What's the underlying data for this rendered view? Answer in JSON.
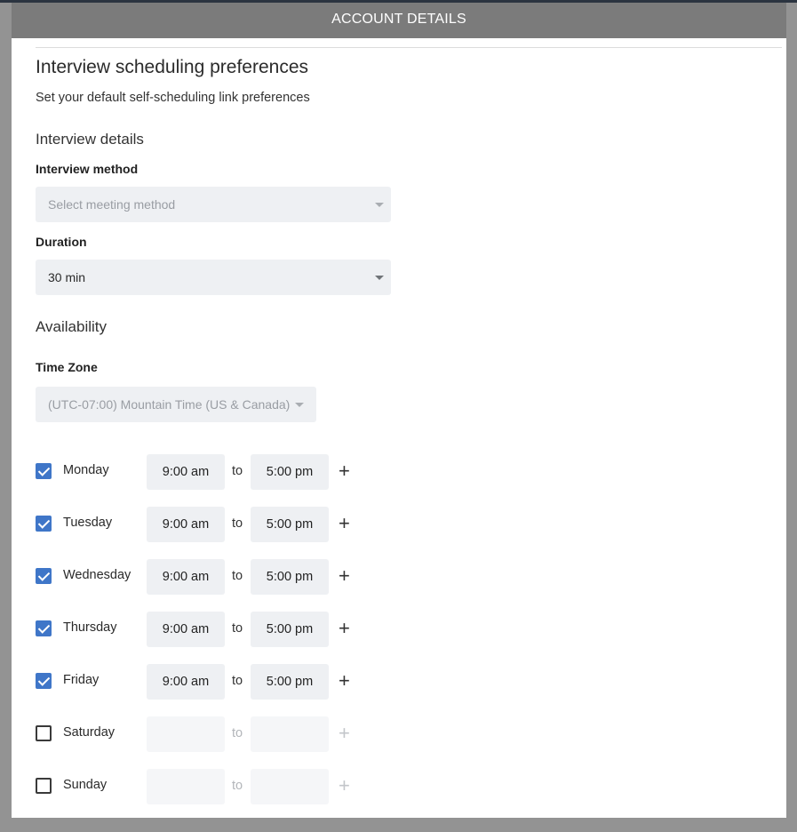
{
  "modal": {
    "title": "ACCOUNT DETAILS"
  },
  "page": {
    "title": "Interview scheduling preferences",
    "subtitle": "Set your default self-scheduling link preferences"
  },
  "interview_details": {
    "section_title": "Interview details",
    "method_label": "Interview method",
    "method_placeholder": "Select meeting method",
    "duration_label": "Duration",
    "duration_value": "30 min"
  },
  "availability": {
    "section_title": "Availability",
    "timezone_label": "Time Zone",
    "timezone_value": "(UTC-07:00) Mountain Time (US & Canada)",
    "to_label": "to",
    "days": [
      {
        "name": "Monday",
        "checked": true,
        "start": "9:00 am",
        "end": "5:00 pm"
      },
      {
        "name": "Tuesday",
        "checked": true,
        "start": "9:00 am",
        "end": "5:00 pm"
      },
      {
        "name": "Wednesday",
        "checked": true,
        "start": "9:00 am",
        "end": "5:00 pm"
      },
      {
        "name": "Thursday",
        "checked": true,
        "start": "9:00 am",
        "end": "5:00 pm"
      },
      {
        "name": "Friday",
        "checked": true,
        "start": "9:00 am",
        "end": "5:00 pm"
      },
      {
        "name": "Saturday",
        "checked": false,
        "start": "",
        "end": ""
      },
      {
        "name": "Sunday",
        "checked": false,
        "start": "",
        "end": ""
      }
    ]
  },
  "icons": {
    "add": "plus-icon",
    "dropdown": "caret-down-icon",
    "checkbox": "check-icon"
  },
  "colors": {
    "checkbox_checked": "#3f76c8",
    "header_bg": "#7b7b7b",
    "field_bg": "#eef0f3"
  }
}
